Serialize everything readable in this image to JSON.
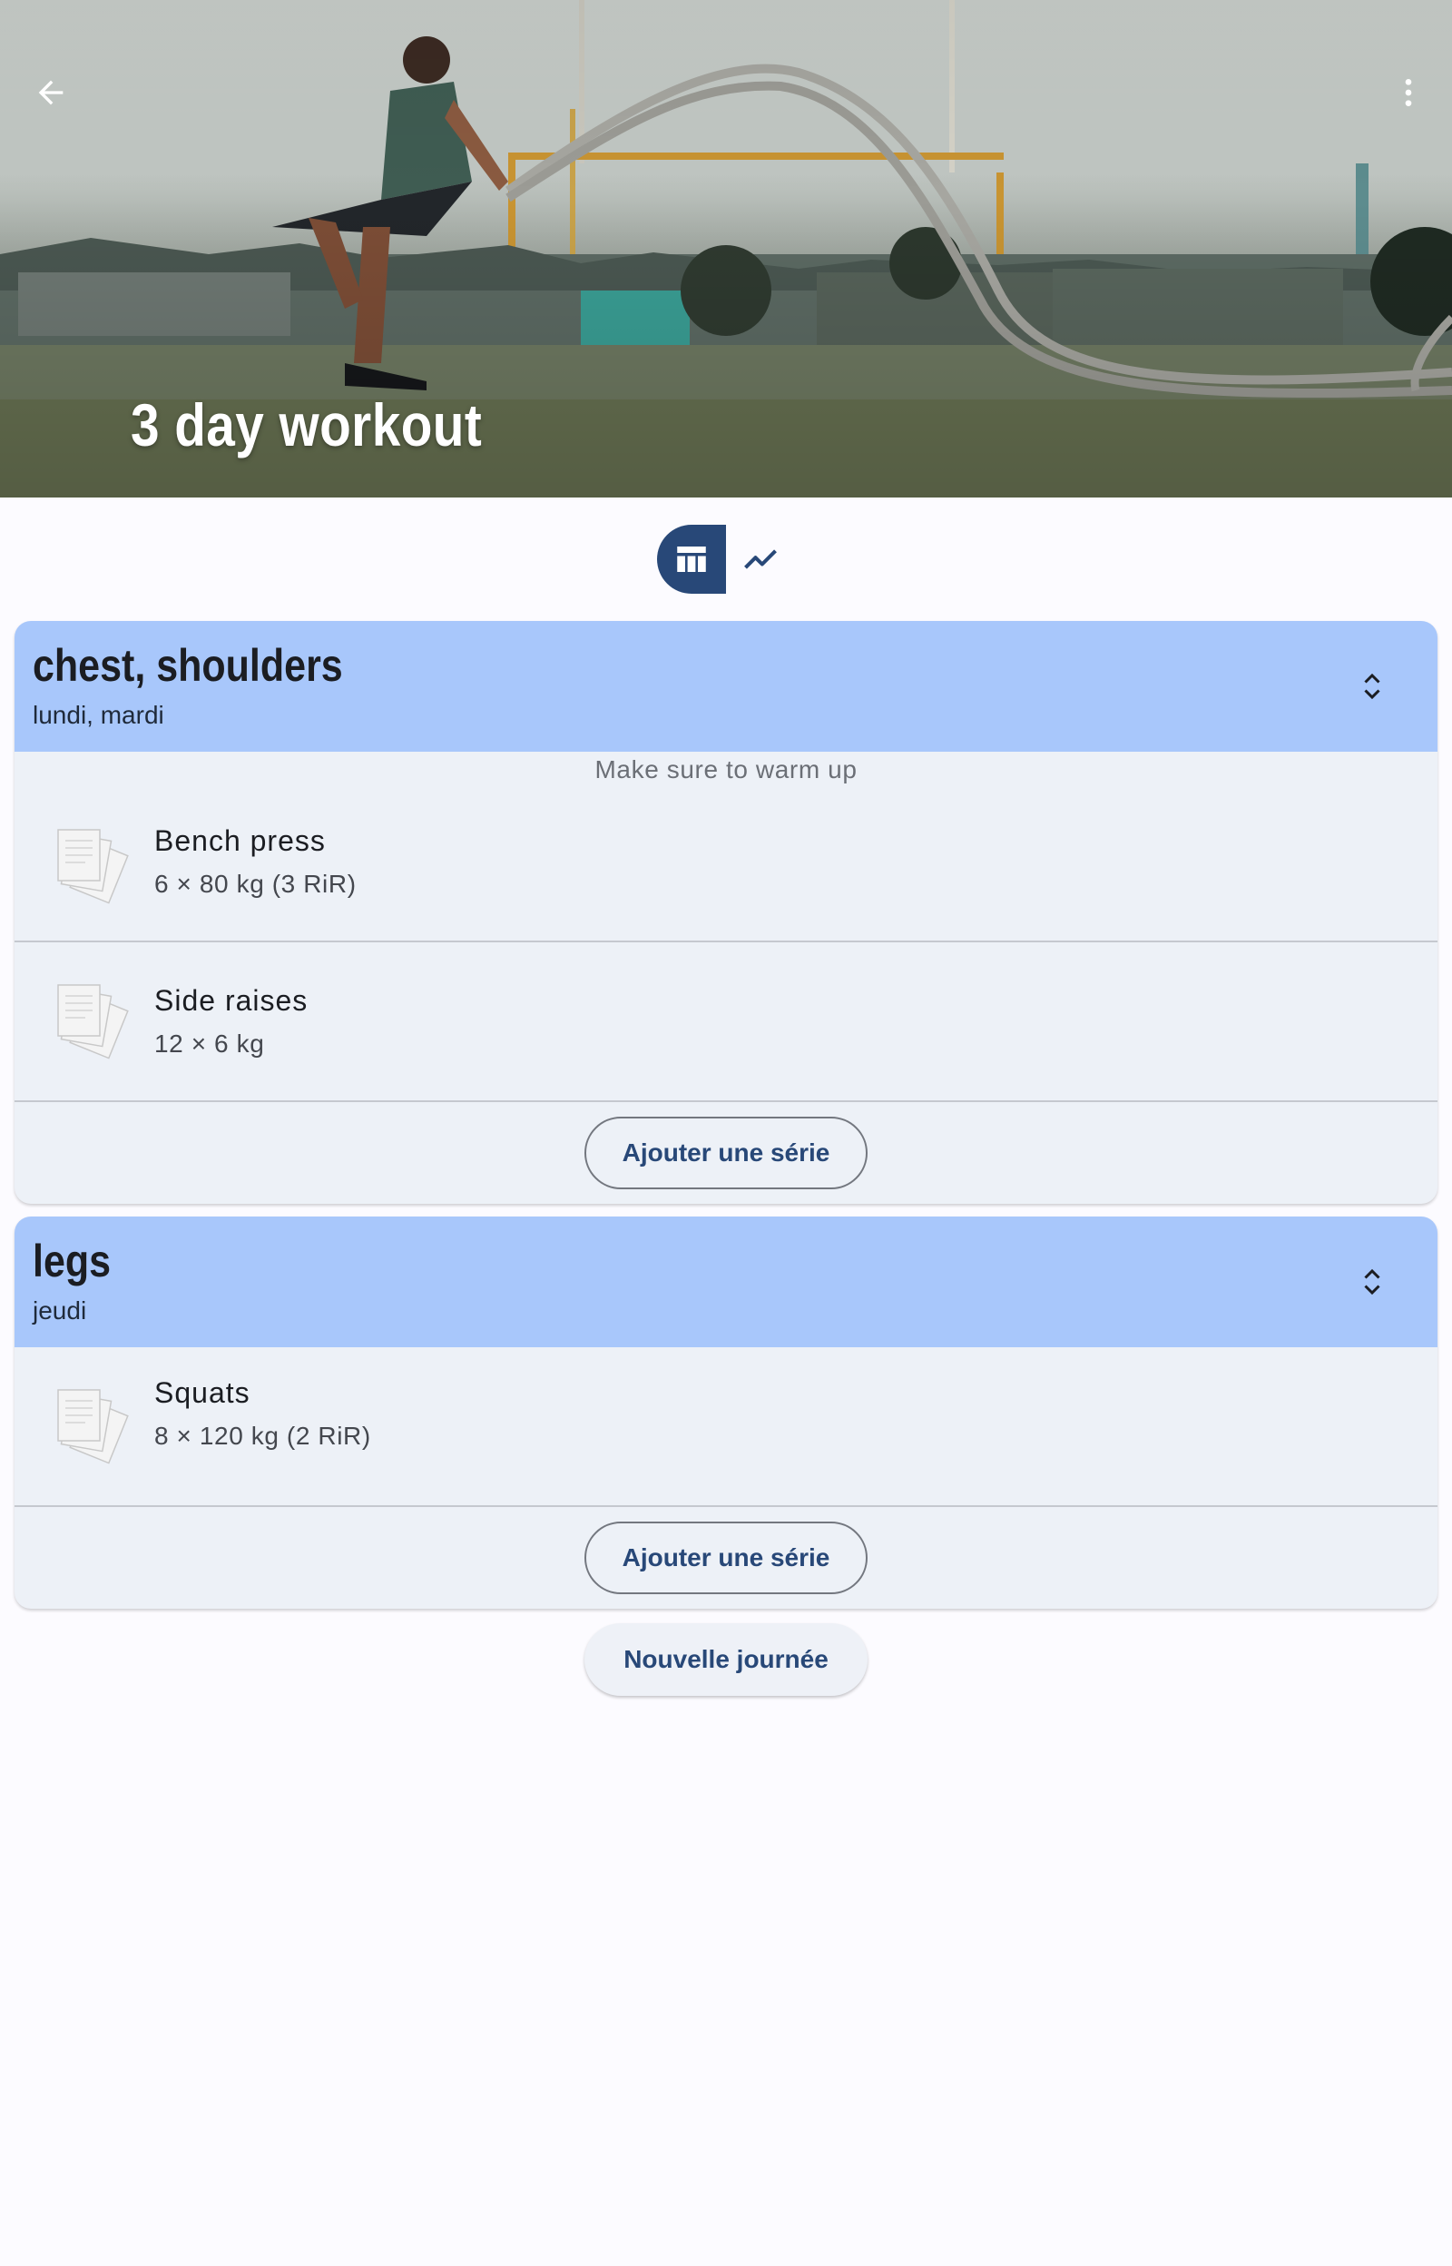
{
  "app_bar": {
    "title": "3 day workout",
    "back_icon": "arrow-back-icon",
    "menu_icon": "more-vertical-icon",
    "hero_image": "man-with-battle-ropes-photo"
  },
  "view_toggle": {
    "options": [
      {
        "icon": "table-icon",
        "selected": true
      },
      {
        "icon": "trending-up-icon",
        "selected": false
      }
    ]
  },
  "days": [
    {
      "title": "chest, shoulders",
      "subtitle": "lundi, mardi",
      "note": "Make sure to warm up",
      "exercises": [
        {
          "name": "Bench press",
          "detail": "6 × 80 kg  (3 RiR)",
          "icon": "documents-icon"
        },
        {
          "name": "Side raises",
          "detail": "12 × 6 kg",
          "icon": "documents-icon"
        }
      ],
      "add_label": "Ajouter une série"
    },
    {
      "title": "legs",
      "subtitle": "jeudi",
      "exercises": [
        {
          "name": "Squats",
          "detail": "8 × 120 kg  (2 RiR)",
          "icon": "documents-icon"
        }
      ],
      "add_label": "Ajouter une série"
    }
  ],
  "new_day_label": "Nouvelle journée",
  "colors": {
    "primary": "#284878",
    "header_bg": "#a8c7fb",
    "card_bg": "#edf1f7",
    "page_bg": "#fcfbff"
  }
}
